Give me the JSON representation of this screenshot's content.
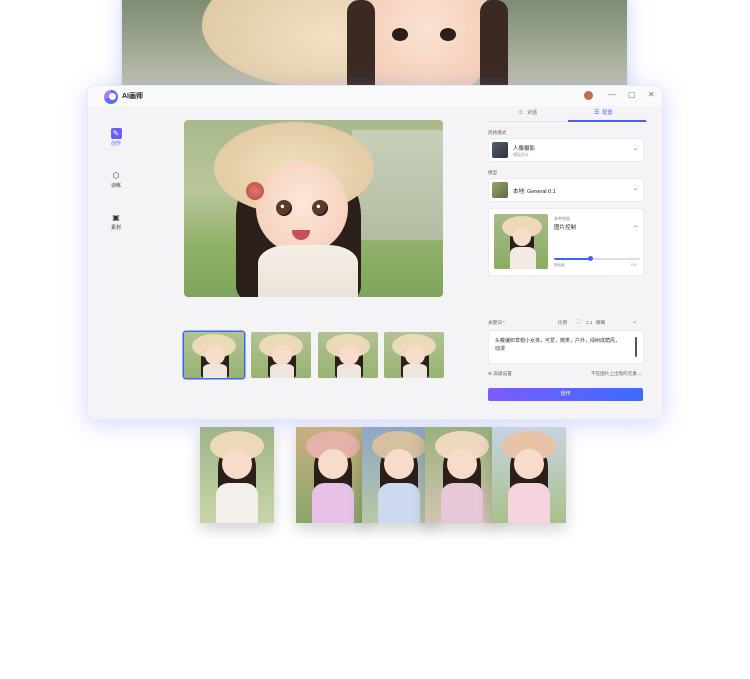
{
  "app": {
    "title": "AI画师",
    "window_controls": {
      "minimize": "—",
      "maximize": "▢",
      "close": "✕"
    }
  },
  "nav": {
    "items": [
      {
        "label": "创作",
        "icon": "create-icon",
        "active": true
      },
      {
        "label": "训练",
        "icon": "cube-icon",
        "active": false
      },
      {
        "label": "素材",
        "icon": "folder-icon",
        "active": false
      }
    ]
  },
  "panel": {
    "tabs": [
      {
        "label": "对话",
        "icon": "chat-icon",
        "active": false
      },
      {
        "label": "配置",
        "icon": "settings-icon",
        "active": true
      }
    ],
    "style_section": {
      "label": "风格模式",
      "title": "人像摄影",
      "subtitle": "模板设计"
    },
    "model_section": {
      "label": "模型",
      "title": "本地: General 0.1"
    },
    "reference": {
      "label": "参考依据",
      "value": "图片控制",
      "slider_value": 0.42,
      "slider_left_label": "相似度",
      "slider_right_label": "0.5"
    },
    "prompt": {
      "label": "关键词 *",
      "ratio_label": "比例",
      "ratio_value": "1:1",
      "quality_label": "精细",
      "text": "头戴编织草帽小女孩，可爱，微笑，户外，绿树成荫风，动漫"
    },
    "advanced_label": "高级设置",
    "advanced_note": "不在图片上出现的元素",
    "create_button": "创作"
  },
  "colors": {
    "accent": "#4a5cff",
    "button_start": "#7c5cff",
    "button_end": "#3c6bff"
  }
}
